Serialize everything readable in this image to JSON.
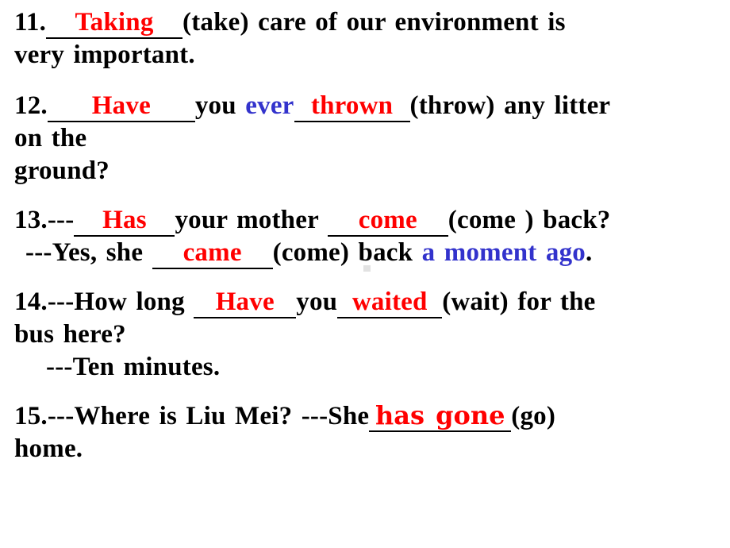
{
  "document": {
    "kind": "grammar-exercise-slide",
    "colors": {
      "answer_red": "#ff0000",
      "hint_blue": "#3333cc",
      "text_black": "#000000",
      "background": "#ffffff"
    }
  },
  "items": [
    {
      "number": "11.",
      "answer1": "Taking",
      "after1": "(take)  care   of  our  environment   is",
      "line2": "very  important."
    },
    {
      "number": "12.",
      "answer1": "Have",
      "mid1": "you ",
      "hint1": "ever",
      "answer2": "thrown",
      "after2": "(throw)  any  litter",
      "line2": "on  the",
      "line3": " ground?"
    },
    {
      "number": "13.",
      "prefix": "---",
      "answer1": "Has",
      "mid1": "your   mother  ",
      "answer2": "come",
      "after2": "(come )  back?",
      "reply_prefix": "---Yes,  she  ",
      "reply_answer": "came",
      "reply_after": "(come)  back ",
      "reply_hint": "a  moment  ago",
      "reply_end": "."
    },
    {
      "number": "14.",
      "prefix": "---How  long ",
      "answer1": "Have",
      "mid1": "you",
      "answer2": "waited",
      "after2": "(wait)  for   the",
      "line2": "bus   here?",
      "reply": "---Ten  minutes."
    },
    {
      "number": "15.",
      "prefix": "---Where   is   Liu  Mei?    ---She",
      "answer1": "has gone",
      "after1": "(go)",
      "line2": "home."
    }
  ]
}
